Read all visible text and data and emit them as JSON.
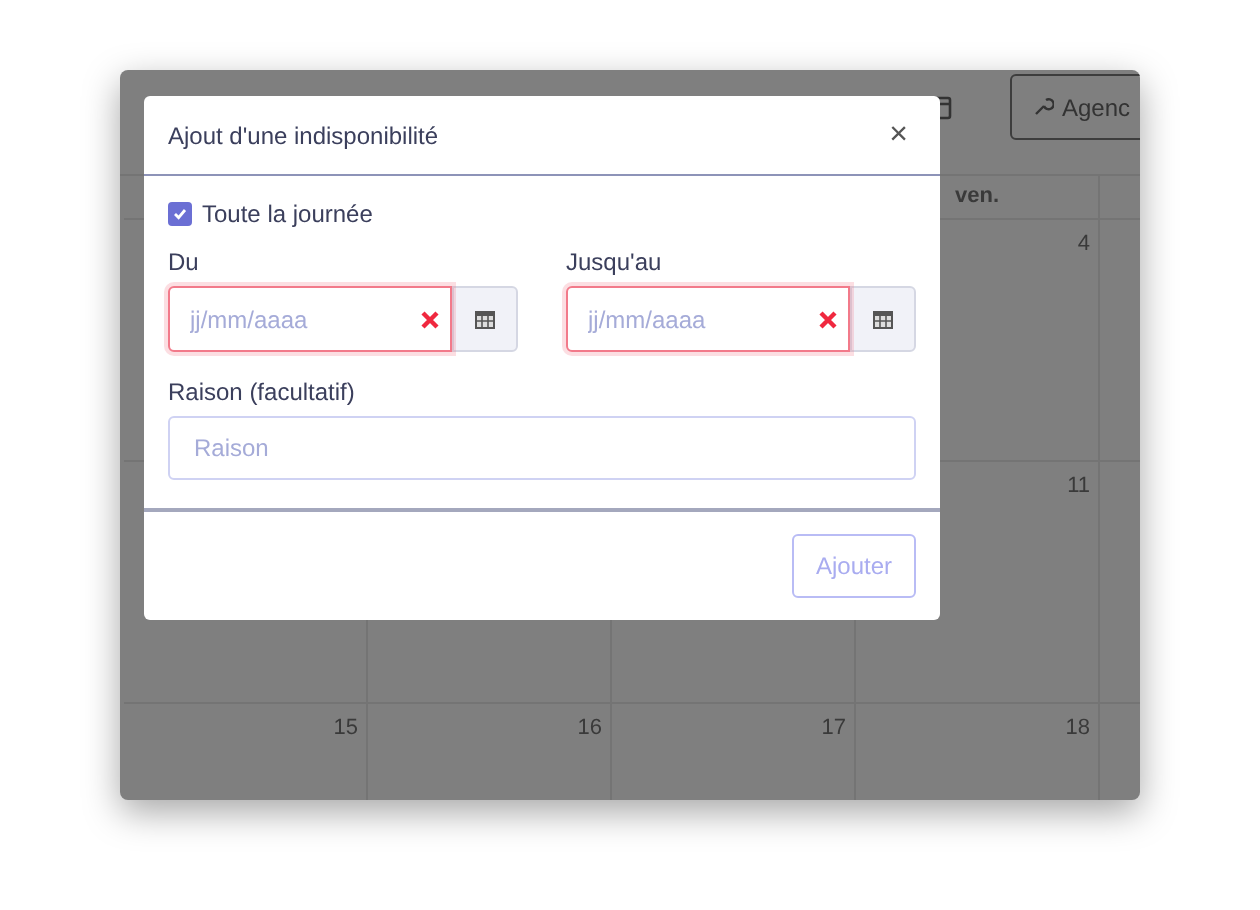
{
  "toolbar": {
    "button": {
      "label": "Agenc"
    }
  },
  "calendar": {
    "header": "ven.",
    "weeks": [
      {
        "days": [
          "4"
        ]
      },
      {
        "days": [
          "11"
        ]
      },
      {
        "days": [
          "15",
          "16",
          "17",
          "18"
        ]
      }
    ]
  },
  "modal": {
    "title": "Ajout d'une indisponibilité",
    "close": "×",
    "all_day": {
      "label": "Toute la journée",
      "checked": true
    },
    "fields": [
      {
        "label": "Du",
        "placeholder": "jj/mm/aaaa",
        "invalid": true
      },
      {
        "label": "Jusqu'au",
        "placeholder": "jj/mm/aaaa",
        "invalid": true
      }
    ],
    "reason": {
      "label": "Raison (facultatif)",
      "placeholder": "Raison"
    },
    "submit": {
      "label": "Ajouter",
      "disabled": true
    }
  }
}
